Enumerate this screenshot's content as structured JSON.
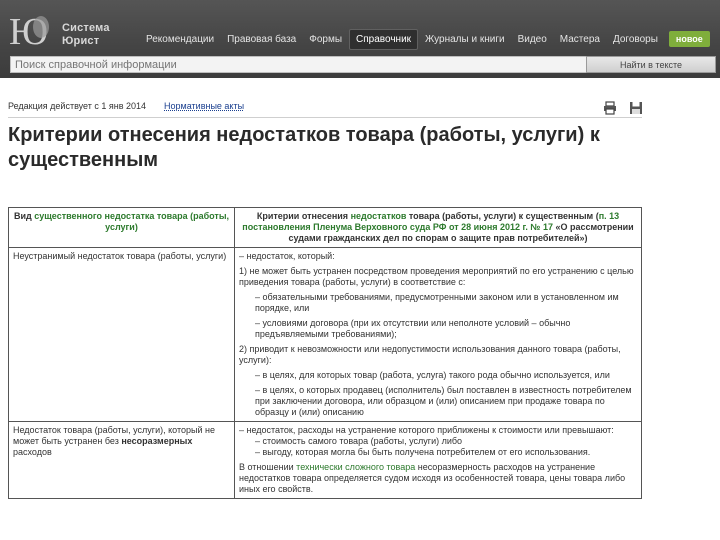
{
  "app": {
    "logo_text": [
      "Система",
      "Юрист"
    ]
  },
  "nav": {
    "items": [
      {
        "label": "Рекомендации",
        "active": false
      },
      {
        "label": "Правовая база",
        "active": false
      },
      {
        "label": "Формы",
        "active": false
      },
      {
        "label": "Справочник",
        "active": true
      },
      {
        "label": "Журналы и книги",
        "active": false
      },
      {
        "label": "Видео",
        "active": false
      },
      {
        "label": "Мастера",
        "active": false
      },
      {
        "label": "Договоры",
        "active": false
      }
    ],
    "badge": "новое"
  },
  "search": {
    "placeholder": "Поиск справочной информации",
    "button": "Найти в тексте"
  },
  "document": {
    "edition": "Редакция действует с 1 янв 2014",
    "norm_link": "Нормативные акты",
    "title": "Критерии отнесения недостатков товара (работы, услуги) к существенным",
    "tools": [
      "print-icon",
      "save-icon"
    ],
    "table": {
      "header": {
        "col1_prefix": "Вид ",
        "col1_link": "существенного недостатка товара (работы, услуги)",
        "col2_prefix": "Критерии отнесения ",
        "col2_link": "недостатков",
        "col2_mid": " товара (работы, услуги) к существенным (",
        "col2_ref": "п. 13 постановления Пленума Верховного суда РФ от 28 июня 2012 г. № 17",
        "col2_tail": " «О рассмотрении судами гражданских дел по спорам о защите прав потребителей»)"
      },
      "rows": [
        {
          "kind": "Неустранимый недостаток товара (работы, услуги)",
          "criteria": [
            {
              "text": "– недостаток, который:",
              "indent": false
            },
            {
              "text": "1) не может быть устранен посредством проведения мероприятий по его устранению с целью приведения товара (работы, услуги) в соответствие с:",
              "indent": false
            },
            {
              "text": "– обязательными требованиями, предусмотренными законом или в установленном им порядке, или",
              "indent": true
            },
            {
              "text": "– условиями договора (при их отсутствии или неполноте условий – обычно предъявляемыми требованиями);",
              "indent": true
            },
            {
              "text": "2) приводит к невозможности или недопустимости использования данного товара (работы, услуги):",
              "indent": false
            },
            {
              "text": "– в целях, для которых товар (работа, услуга) такого рода обычно используется, или",
              "indent": true
            },
            {
              "text": "– в целях, о которых продавец (исполнитель) был поставлен в известность потребителем при заключении договора, или образцом и (или) описанием при продаже товара по образцу и (или) описанию",
              "indent": true
            }
          ]
        },
        {
          "kind_prefix": "Недостаток товара (работы, услуги), который не может быть устранен без ",
          "kind_bold": "несоразмерных",
          "kind_suffix": " расходов",
          "criteria": [
            {
              "text": "– недостаток, расходы на устранение которого приближены к стоимости или превышают:",
              "indent": false
            },
            {
              "text": "– стоимость самого товара (работы, услуги) либо",
              "indent": true
            },
            {
              "text": "– выгоду, которая могла бы быть получена потребителем от его использования.",
              "indent": true
            }
          ],
          "note_prefix": "В отношении ",
          "note_link": "технически сложного товара",
          "note_suffix": " несоразмерность расходов на устранение недостатков товара определяется судом исходя из особенностей товара, цены товара либо иных его свойств."
        }
      ]
    }
  }
}
